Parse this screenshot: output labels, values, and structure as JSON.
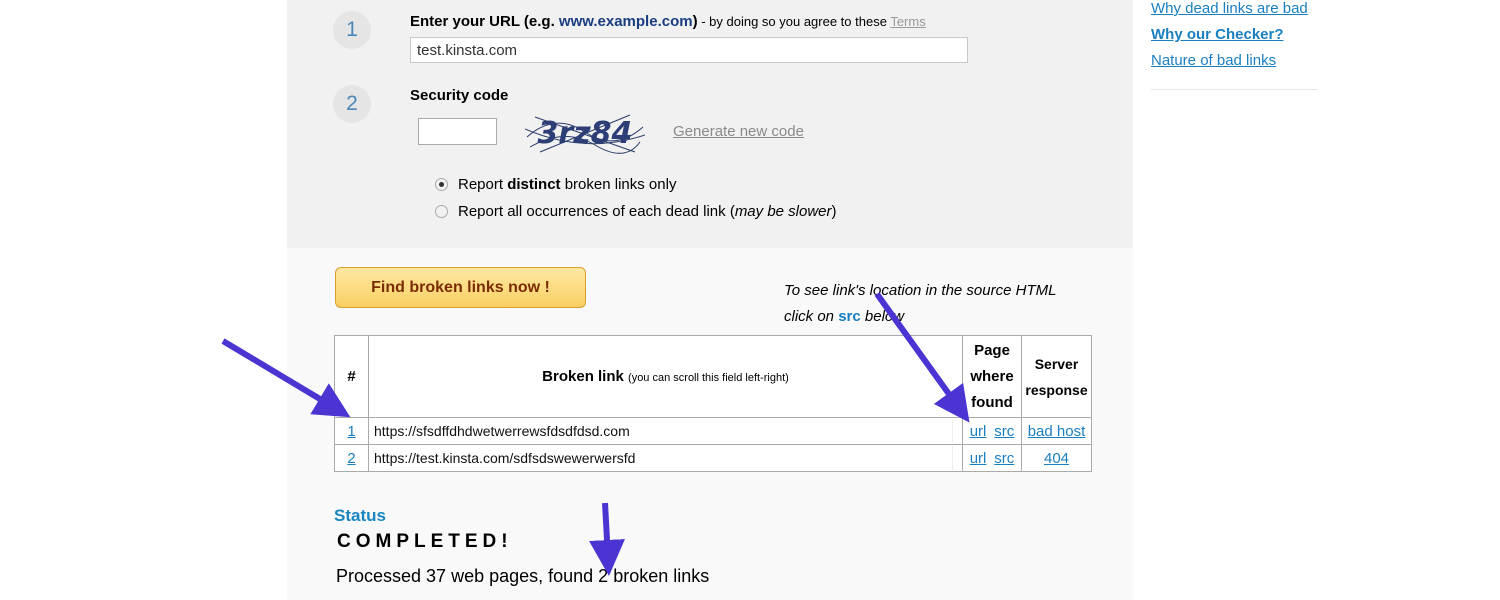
{
  "step1": {
    "number": "1",
    "label": "Enter your URL (e.g.",
    "example": "www.example.com",
    "close": ")",
    "agree": " - by doing so you agree to these ",
    "terms_link": "Terms",
    "url_value": "test.kinsta.com"
  },
  "step2": {
    "number": "2",
    "label": "Security code",
    "captcha_text": "3rz84",
    "generate_link": "Generate new code"
  },
  "options": [
    {
      "pre": "Report ",
      "bold": "distinct",
      "post": " broken links only",
      "checked": true
    },
    {
      "pre": "Report all occurrences of each dead link (",
      "italic": "may be slower",
      "post": ")",
      "checked": false
    }
  ],
  "find_button": "Find broken links now !",
  "hint": {
    "line1": "To see link's location in the source HTML",
    "line2_pre": "click on ",
    "line2_src": "src",
    "line2_post": " below"
  },
  "table": {
    "headers": {
      "num": "#",
      "link": "Broken link",
      "link_note": "(you can scroll this field left-right)",
      "page": "Page where found",
      "server": "Server response"
    },
    "rows": [
      {
        "num": "1",
        "link": "https://sfsdffdhdwetwerrewsfdsdfdsd.com",
        "url": "url",
        "src": "src",
        "response": "bad host"
      },
      {
        "num": "2",
        "link": "https://test.kinsta.com/sdfsdswewerwersfd",
        "url": "url",
        "src": "src",
        "response": "404"
      }
    ]
  },
  "status": {
    "title": "Status",
    "state": "COMPLETED!",
    "summary": "Processed 37 web pages, found 2 broken links"
  },
  "sidebar": {
    "links": [
      "Why dead links are bad",
      "Why our Checker?",
      "Nature of bad links"
    ]
  },
  "colors": {
    "link": "#1a7fc0",
    "annotation_arrow": "#4a35d3",
    "button": "#f9cf62"
  }
}
